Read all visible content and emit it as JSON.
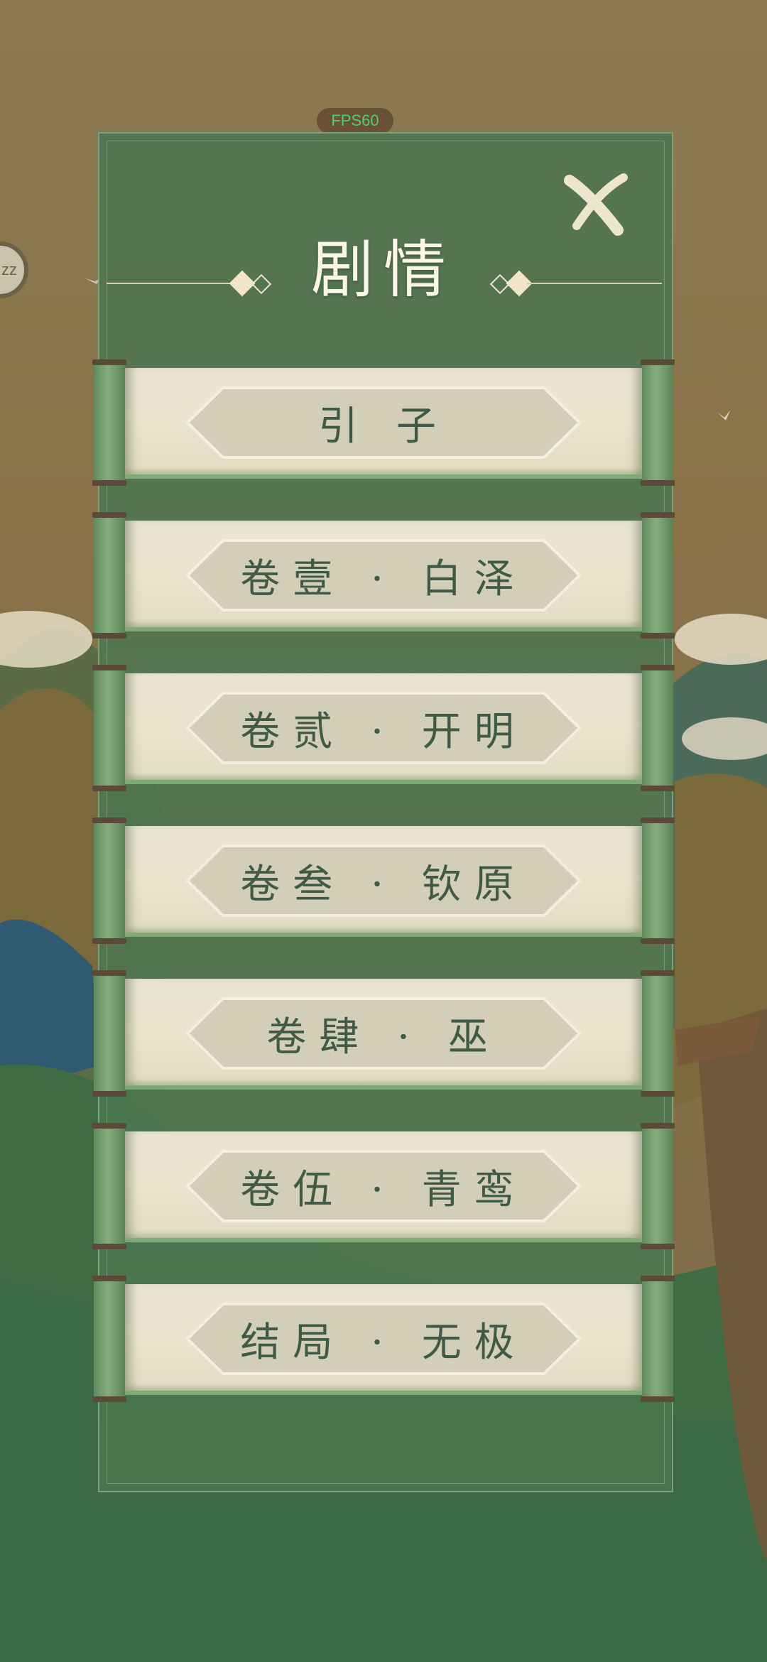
{
  "hud": {
    "fps": "FPS60",
    "side_bubble": "zz"
  },
  "panel": {
    "title": "剧情"
  },
  "chapters": [
    {
      "label": "引 子"
    },
    {
      "label": "卷壹 · 白泽"
    },
    {
      "label": "卷贰 · 开明"
    },
    {
      "label": "卷叁 · 钦原"
    },
    {
      "label": "卷肆 · 巫"
    },
    {
      "label": "卷伍 · 青鸾"
    },
    {
      "label": "结局 · 无极"
    }
  ],
  "colors": {
    "panel": "#4f7a52",
    "paper": "#e9e4d0",
    "text": "#3f5a45",
    "title": "#fbf6e6",
    "fps": "#4fd06a"
  },
  "icons": {
    "close": "close-icon",
    "title_ornament": "diamond-ornament-icon"
  }
}
